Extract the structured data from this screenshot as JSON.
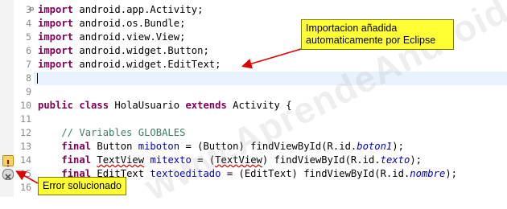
{
  "lines": [
    {
      "num": "3",
      "fold": "⊖"
    },
    {
      "num": "4"
    },
    {
      "num": "5"
    },
    {
      "num": "6"
    },
    {
      "num": "7"
    },
    {
      "num": "8"
    },
    {
      "num": "9"
    },
    {
      "num": "10"
    },
    {
      "num": "11"
    },
    {
      "num": "12"
    },
    {
      "num": "13"
    },
    {
      "num": "14"
    },
    {
      "num": "15"
    },
    {
      "num": "16"
    }
  ],
  "code": {
    "l3_kw": "import",
    "l3_rest": " android.app.Activity;",
    "l4_kw": "import",
    "l4_rest": " android.os.Bundle;",
    "l5_kw": "import",
    "l5_rest": " android.view.View;",
    "l6_kw": "import",
    "l6_rest": " android.widget.Button;",
    "l7_kw": "import",
    "l7_rest": " android.widget.EditText;",
    "l10_kw1": "public",
    "l10_kw2": "class",
    "l10_name": " HolaUsuario ",
    "l10_kw3": "extends",
    "l10_rest": " Activity {",
    "l12_comment": "    // Variables GLOBALES",
    "l13_indent": "    ",
    "l13_kw": "final",
    "l13_a": " Button ",
    "l13_field": "miboton",
    "l13_b": " = (Button) findViewById(R.id.",
    "l13_id": "boton1",
    "l13_c": ");",
    "l14_indent": "    ",
    "l14_kw": "final",
    "l14_sp": " ",
    "l14_type": "TextView",
    "l14_sp2": " ",
    "l14_field": "mitexto",
    "l14_b": " = (",
    "l14_cast": "TextView",
    "l14_c": ") findViewById(R.id.",
    "l14_id": "texto",
    "l14_d": ");",
    "l15_indent": "    ",
    "l15_kw": "final",
    "l15_a": " EditText ",
    "l15_field": "textoeditado",
    "l15_b": " = (EditText) findViewById(R.id.",
    "l15_id": "nombre",
    "l15_c": ");"
  },
  "callouts": {
    "top": "Importacion añadida automaticamente por Eclipse",
    "bottom": "Error solucionado"
  },
  "watermark": "www.AprendeAndroid.com",
  "colors": {
    "keyword": "#7f0055",
    "comment": "#3f7f5f",
    "field": "#0000c0",
    "callout": "#ffff33",
    "arrow": "#e00000"
  }
}
